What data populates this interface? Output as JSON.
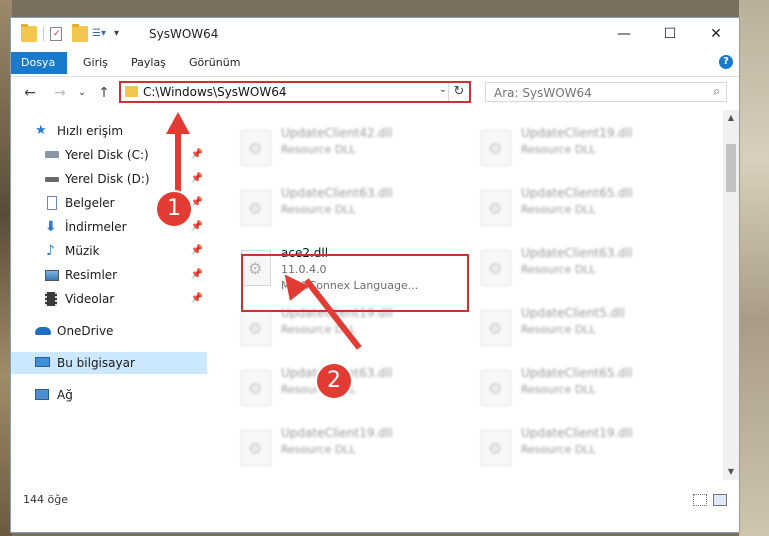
{
  "window": {
    "title": "SysWOW64",
    "buttons": {
      "minimize": "—",
      "maximize": "☐",
      "close": "✕"
    }
  },
  "ribbon": {
    "tabs": [
      "Dosya",
      "Giriş",
      "Paylaş",
      "Görünüm"
    ],
    "help": "?"
  },
  "nav": {
    "back": "←",
    "forward": "→",
    "recent": "⌄",
    "up": "↑",
    "address": "C:\\Windows\\SysWOW64",
    "dropdown": "⌄",
    "refresh": "↻"
  },
  "search": {
    "placeholder": "Ara: SysWOW64",
    "icon": "⌕"
  },
  "sidebar": {
    "items": [
      {
        "label": "Hızlı erişim",
        "icon": "star-icon"
      },
      {
        "label": "Yerel Disk (C:)",
        "icon": "drive-icon",
        "pinned": true
      },
      {
        "label": "Yerel Disk (D:)",
        "icon": "drive-icon",
        "pinned": true
      },
      {
        "label": "Belgeler",
        "icon": "document-icon",
        "pinned": true
      },
      {
        "label": "İndirmeler",
        "icon": "download-icon",
        "pinned": true
      },
      {
        "label": "Müzik",
        "icon": "music-icon",
        "pinned": true
      },
      {
        "label": "Resimler",
        "icon": "picture-icon",
        "pinned": true
      },
      {
        "label": "Videolar",
        "icon": "video-icon",
        "pinned": true
      },
      {
        "label": "OneDrive",
        "icon": "cloud-icon"
      },
      {
        "label": "Bu bilgisayar",
        "icon": "computer-icon",
        "selected": true
      },
      {
        "label": "Ağ",
        "icon": "network-icon"
      }
    ],
    "pin_glyph": "📌"
  },
  "files": [
    {
      "name": "UpdateClient42.dll",
      "type": "Resource DLL"
    },
    {
      "name": "UpdateClient19.dll",
      "type": "Resource DLL"
    },
    {
      "name": "UpdateClient63.dll",
      "type": "Resource DLL"
    },
    {
      "name": "UpdateClient65.dll",
      "type": "Resource DLL"
    },
    {
      "name": "ace2.dll",
      "version": "11.0.4.0",
      "type": "MathConnex Language...",
      "highlighted": true
    },
    {
      "name": "UpdateClient63.dll",
      "type": "Resource DLL"
    },
    {
      "name": "UpdateClient19.dll",
      "type": "Resource DLL"
    },
    {
      "name": "UpdateClient5.dll",
      "type": "Resource DLL"
    },
    {
      "name": "UpdateClient63.dll",
      "type": "Resource DLL"
    },
    {
      "name": "UpdateClient65.dll",
      "type": "Resource DLL"
    },
    {
      "name": "UpdateClient19.dll",
      "type": "Resource DLL"
    },
    {
      "name": "UpdateClient19.dll",
      "type": "Resource DLL"
    }
  ],
  "status": {
    "count": "144 öğe"
  },
  "annotations": {
    "step1": "1",
    "step2": "2"
  },
  "colors": {
    "accent": "#1979ca",
    "annotation": "#e23b34",
    "selected": "#cce8ff"
  }
}
